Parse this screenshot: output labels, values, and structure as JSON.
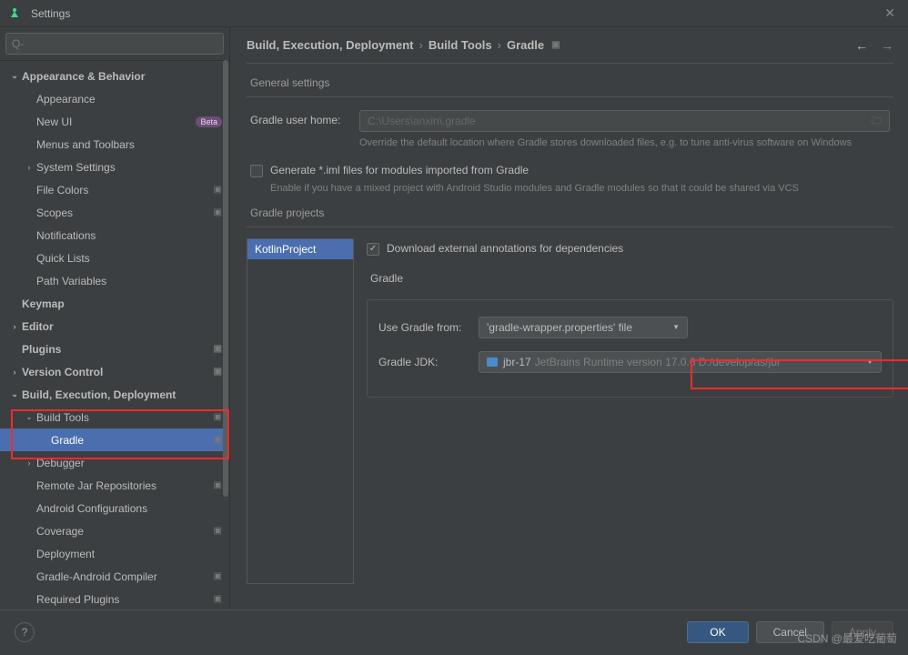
{
  "window": {
    "title": "Settings"
  },
  "search": {
    "placeholder": "Q-"
  },
  "breadcrumb": {
    "a": "Build, Execution, Deployment",
    "b": "Build Tools",
    "c": "Gradle"
  },
  "sidebar": {
    "items": [
      {
        "label": "Appearance & Behavior",
        "depth": 0,
        "arrow": "v",
        "bold": true
      },
      {
        "label": "Appearance",
        "depth": 1
      },
      {
        "label": "New UI",
        "depth": 1,
        "badge": "Beta"
      },
      {
        "label": "Menus and Toolbars",
        "depth": 1
      },
      {
        "label": "System Settings",
        "depth": 1,
        "arrow": ">"
      },
      {
        "label": "File Colors",
        "depth": 1,
        "proj": true
      },
      {
        "label": "Scopes",
        "depth": 1,
        "proj": true
      },
      {
        "label": "Notifications",
        "depth": 1
      },
      {
        "label": "Quick Lists",
        "depth": 1
      },
      {
        "label": "Path Variables",
        "depth": 1
      },
      {
        "label": "Keymap",
        "depth": 0,
        "bold": true
      },
      {
        "label": "Editor",
        "depth": 0,
        "arrow": ">",
        "bold": true
      },
      {
        "label": "Plugins",
        "depth": 0,
        "bold": true,
        "proj": true
      },
      {
        "label": "Version Control",
        "depth": 0,
        "arrow": ">",
        "bold": true,
        "proj": true
      },
      {
        "label": "Build, Execution, Deployment",
        "depth": 0,
        "arrow": "v",
        "bold": true
      },
      {
        "label": "Build Tools",
        "depth": 1,
        "arrow": "v",
        "proj": true
      },
      {
        "label": "Gradle",
        "depth": 2,
        "proj": true,
        "selected": true
      },
      {
        "label": "Debugger",
        "depth": 1,
        "arrow": ">"
      },
      {
        "label": "Remote Jar Repositories",
        "depth": 1,
        "proj": true
      },
      {
        "label": "Android Configurations",
        "depth": 1
      },
      {
        "label": "Coverage",
        "depth": 1,
        "proj": true
      },
      {
        "label": "Deployment",
        "depth": 1
      },
      {
        "label": "Gradle-Android Compiler",
        "depth": 1,
        "proj": true
      },
      {
        "label": "Required Plugins",
        "depth": 1,
        "proj": true
      }
    ]
  },
  "general": {
    "title": "General settings",
    "userHomeLabel": "Gradle user home:",
    "userHomeValue": "C:\\Users\\anxin\\.gradle",
    "userHomeHint": "Override the default location where Gradle stores downloaded files, e.g. to tune anti-virus software on Windows",
    "imlLabel": "Generate *.iml files for modules imported from Gradle",
    "imlHint": "Enable if you have a mixed project with Android Studio modules and Gradle modules so that it could be shared via VCS"
  },
  "projects": {
    "title": "Gradle projects",
    "item": "KotlinProject",
    "downloadLabel": "Download external annotations for dependencies",
    "fieldset": "Gradle",
    "useFromLabel": "Use Gradle from:",
    "useFromValue": "'gradle-wrapper.properties' file",
    "jdkLabel": "Gradle JDK:",
    "jdkName": "jbr-17",
    "jdkDesc": "JetBrains Runtime version 17.0.6 D:/develop/as/jbr"
  },
  "footer": {
    "ok": "OK",
    "cancel": "Cancel",
    "apply": "Apply",
    "help": "?"
  },
  "watermark": "CSDN @最爱吃葡萄"
}
